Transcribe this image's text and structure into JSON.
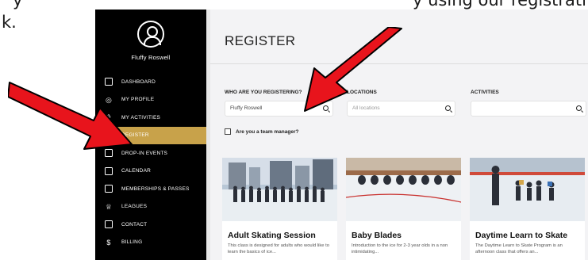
{
  "doc": {
    "left_fragment_top": "y",
    "left_fragment_bottom": "k.",
    "right_fragment": "y using our registrati"
  },
  "sidebar": {
    "user_name": "Fluffy Roswell",
    "items": [
      {
        "label": "DASHBOARD",
        "icon": "dashboard-icon",
        "glyph": "▭"
      },
      {
        "label": "MY PROFILE",
        "icon": "profile-icon",
        "glyph": "◎"
      },
      {
        "label": "MY ACTIVITIES",
        "icon": "activities-icon",
        "glyph": "⚘"
      },
      {
        "label": "REGISTER",
        "icon": "register-icon",
        "glyph": "≡",
        "active": true
      },
      {
        "label": "DROP-IN EVENTS",
        "icon": "drop-in-icon",
        "glyph": "⊟"
      },
      {
        "label": "CALENDAR",
        "icon": "calendar-icon",
        "glyph": "▦"
      },
      {
        "label": "MEMBERSHIPS & PASSES",
        "icon": "memberships-icon",
        "glyph": "▣"
      },
      {
        "label": "LEAGUES",
        "icon": "leagues-icon",
        "glyph": "♕"
      },
      {
        "label": "CONTACT",
        "icon": "contact-icon",
        "glyph": "⌨"
      },
      {
        "label": "BILLING",
        "icon": "billing-icon",
        "glyph": "$"
      }
    ]
  },
  "main": {
    "title": "REGISTER",
    "filters": {
      "who_label": "WHO ARE YOU REGISTERING?",
      "who_value": "Fluffy Roswell",
      "locations_label": "LOCATIONS",
      "locations_placeholder": "All locations",
      "activities_label": "ACTIVITIES",
      "activities_value": ""
    },
    "team_manager_label": "Are you a team manager?",
    "cards": [
      {
        "title": "Adult Skating Session",
        "desc": "This class is designed for adults who would like to learn the basics of ice..."
      },
      {
        "title": "Baby Blades",
        "desc": "Introduction to the ice for 2-3 year olds in a non intimidating..."
      },
      {
        "title": "Daytime Learn to Skate",
        "desc": "The Daytime Learn to Skate Program is an afternoon class that offers an..."
      }
    ]
  },
  "colors": {
    "sidebar_bg": "#000000",
    "active_item": "#c8a24a",
    "annotation_arrow": "#e8141c"
  }
}
